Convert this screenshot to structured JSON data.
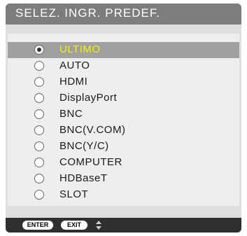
{
  "dialog": {
    "title": "SELEZ. INGR. PREDEF.",
    "options": [
      {
        "label": "ULTIMO",
        "selected": true
      },
      {
        "label": "AUTO",
        "selected": false
      },
      {
        "label": "HDMI",
        "selected": false
      },
      {
        "label": "DisplayPort",
        "selected": false
      },
      {
        "label": "BNC",
        "selected": false
      },
      {
        "label": "BNC(V.COM)",
        "selected": false
      },
      {
        "label": "BNC(Y/C)",
        "selected": false
      },
      {
        "label": "COMPUTER",
        "selected": false
      },
      {
        "label": "HDBaseT",
        "selected": false
      },
      {
        "label": "SLOT",
        "selected": false
      }
    ]
  },
  "footer": {
    "enter_label": "ENTER",
    "exit_label": "EXIT",
    "nav_icon": "up-down-arrow-icon"
  },
  "colors": {
    "title_bar": "#7d7d7d",
    "selected_row": "#a0a0a0",
    "selected_text": "#f8f000",
    "footer": "#2f2f2f"
  }
}
